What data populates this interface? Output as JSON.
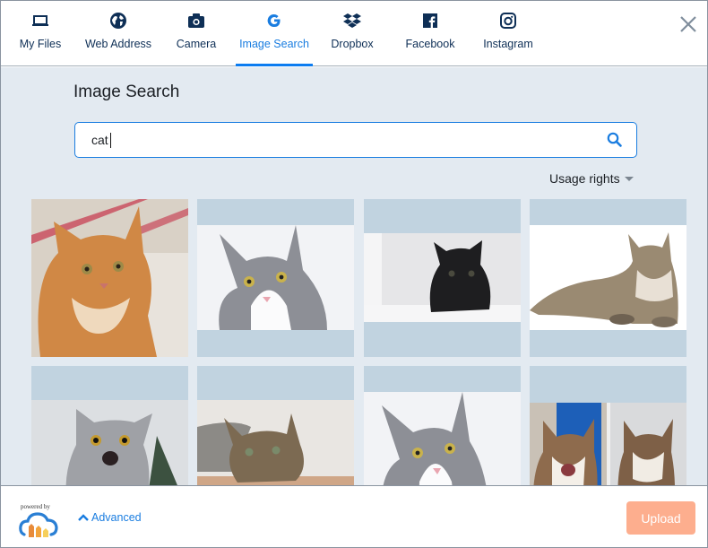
{
  "tabs": [
    {
      "id": "my-files",
      "label": "My Files",
      "icon": "laptop-icon",
      "active": false
    },
    {
      "id": "web-address",
      "label": "Web Address",
      "icon": "globe-icon",
      "active": false
    },
    {
      "id": "camera",
      "label": "Camera",
      "icon": "camera-icon",
      "active": false
    },
    {
      "id": "image-search",
      "label": "Image Search",
      "icon": "google-icon",
      "active": true
    },
    {
      "id": "dropbox",
      "label": "Dropbox",
      "icon": "dropbox-icon",
      "active": false
    },
    {
      "id": "facebook",
      "label": "Facebook",
      "icon": "facebook-icon",
      "active": false
    },
    {
      "id": "instagram",
      "label": "Instagram",
      "icon": "instagram-icon",
      "active": false
    }
  ],
  "close": {
    "icon": "close-icon"
  },
  "main": {
    "title": "Image Search",
    "search": {
      "value": "cat",
      "placeholder": ""
    },
    "usage_rights_label": "Usage rights"
  },
  "results": [
    {
      "alt": "orange tabby cat"
    },
    {
      "alt": "grey and white kitten"
    },
    {
      "alt": "black cat on white blanket"
    },
    {
      "alt": "tabby cat lying down"
    },
    {
      "alt": "surprised grey cat"
    },
    {
      "alt": "long-haired tabby cat resting"
    },
    {
      "alt": "grey and white kitten close-up"
    },
    {
      "alt": "laughing calico cats"
    }
  ],
  "footer": {
    "powered_by": "powered by",
    "advanced_label": "Advanced",
    "upload_label": "Upload"
  },
  "colors": {
    "accent": "#1a7de0",
    "nav_text": "#0e2f56",
    "upload_disabled": "#fdae8e",
    "content_bg": "#e3eaf1",
    "tile_bg": "#c1d3e0"
  }
}
